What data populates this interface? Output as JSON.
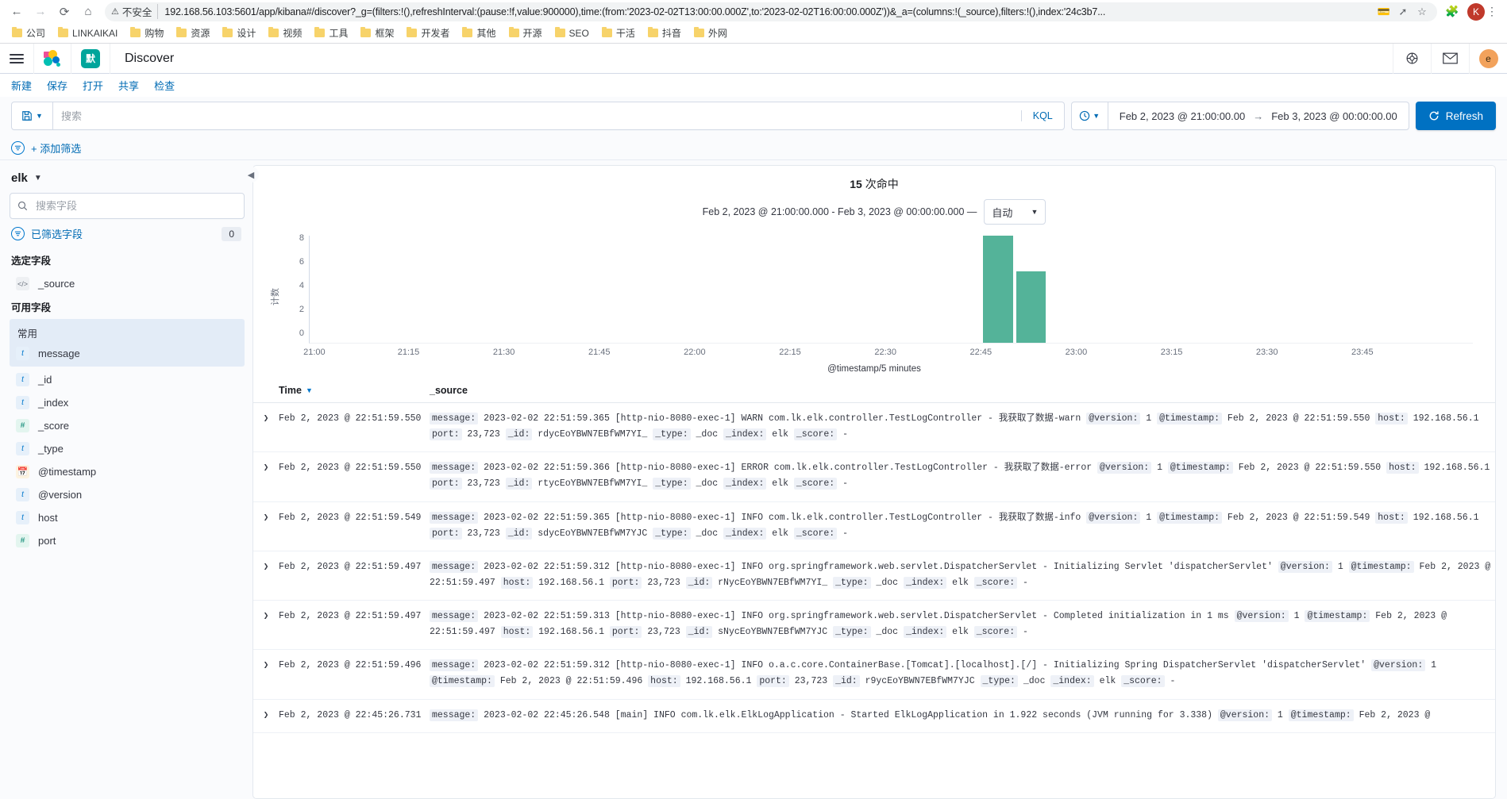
{
  "browser": {
    "back_icon": "←",
    "forward_icon": "→",
    "reload_icon": "⟳",
    "home_icon": "⌂",
    "security_label": "不安全",
    "url": "192.168.56.103:5601/app/kibana#/discover?_g=(filters:!(),refreshInterval:(pause:!f,value:900000),time:(from:'2023-02-02T13:00:00.000Z',to:'2023-02-02T16:00:00.000Z'))&_a=(columns:!(_source),filters:!(),index:'24c3b7...",
    "profile_initial": "K",
    "bookmarks": [
      {
        "label": "公司"
      },
      {
        "label": "LINKAIKAI"
      },
      {
        "label": "购物"
      },
      {
        "label": "资源"
      },
      {
        "label": "设计"
      },
      {
        "label": "视频"
      },
      {
        "label": "工具"
      },
      {
        "label": "框架"
      },
      {
        "label": "开发者"
      },
      {
        "label": "其他"
      },
      {
        "label": "开源"
      },
      {
        "label": "SEO"
      },
      {
        "label": "干活"
      },
      {
        "label": "抖音"
      },
      {
        "label": "外网"
      }
    ]
  },
  "header": {
    "space_badge": "默",
    "app_title": "Discover",
    "avatar_initial": "e"
  },
  "topnav": [
    {
      "label": "新建"
    },
    {
      "label": "保存"
    },
    {
      "label": "打开"
    },
    {
      "label": "共享"
    },
    {
      "label": "检查"
    }
  ],
  "query": {
    "placeholder": "搜索",
    "value": "",
    "language": "KQL",
    "date_from": "Feb 2, 2023 @ 21:00:00.00",
    "date_to": "Feb 3, 2023 @ 00:00:00.00",
    "range_arrow": "→",
    "refresh_label": "Refresh"
  },
  "filters": {
    "add_filter_label": "+ 添加筛选"
  },
  "sidebar": {
    "index_pattern": "elk",
    "field_search_placeholder": "搜索字段",
    "filtered_fields_label": "已筛选字段",
    "filtered_fields_count": "0",
    "selected_fields_title": "选定字段",
    "available_fields_title": "可用字段",
    "popular_group_title": "常用",
    "selected_fields": [
      {
        "name": "_source",
        "type": "source"
      }
    ],
    "popular_fields": [
      {
        "name": "message",
        "type": "string"
      }
    ],
    "available_fields": [
      {
        "name": "_id",
        "type": "string"
      },
      {
        "name": "_index",
        "type": "string"
      },
      {
        "name": "_score",
        "type": "number"
      },
      {
        "name": "_type",
        "type": "string"
      },
      {
        "name": "@timestamp",
        "type": "date"
      },
      {
        "name": "@version",
        "type": "string"
      },
      {
        "name": "host",
        "type": "string"
      },
      {
        "name": "port",
        "type": "number"
      }
    ]
  },
  "histogram": {
    "hits_count": "15",
    "hits_label": "次命中",
    "range_text": "Feb 2, 2023 @ 21:00:00.000 - Feb 3, 2023 @ 00:00:00.000 —",
    "interval_value": "自动"
  },
  "chart_data": {
    "type": "bar",
    "title": "15 次命中",
    "xlabel": "@timestamp/5 minutes",
    "ylabel": "计数",
    "categories": [
      "21:00",
      "21:05",
      "21:10",
      "21:15",
      "21:20",
      "21:25",
      "21:30",
      "21:35",
      "21:40",
      "21:45",
      "21:50",
      "21:55",
      "22:00",
      "22:05",
      "22:10",
      "22:15",
      "22:20",
      "22:25",
      "22:30",
      "22:35",
      "22:40",
      "22:45",
      "22:50",
      "22:55",
      "23:00",
      "23:05",
      "23:10",
      "23:15",
      "23:20",
      "23:25",
      "23:30",
      "23:35",
      "23:40",
      "23:45",
      "23:50",
      "23:55"
    ],
    "values": [
      0,
      0,
      0,
      0,
      0,
      0,
      0,
      0,
      0,
      0,
      0,
      0,
      0,
      0,
      0,
      0,
      0,
      0,
      0,
      0,
      0,
      9,
      6,
      0,
      0,
      0,
      0,
      0,
      0,
      0,
      0,
      0,
      0,
      0,
      0,
      0
    ],
    "x_ticks": [
      "21:00",
      "21:15",
      "21:30",
      "21:45",
      "22:00",
      "22:15",
      "22:30",
      "22:45",
      "23:00",
      "23:15",
      "23:30",
      "23:45"
    ],
    "y_ticks": [
      "0",
      "2",
      "4",
      "6",
      "8"
    ],
    "ylim": [
      0,
      9
    ],
    "grid": false,
    "legend": "none",
    "bar_color": "#54b399"
  },
  "table": {
    "columns": {
      "time": "Time",
      "source": "_source"
    },
    "rows": [
      {
        "time": "Feb 2, 2023 @ 22:51:59.550",
        "parts": [
          {
            "k": "message:",
            "v": "2023-02-02 22:51:59.365 [http-nio-8080-exec-1] WARN com.lk.elk.controller.TestLogController - 我获取了数据-warn"
          },
          {
            "k": "@version:",
            "v": "1"
          },
          {
            "k": "@timestamp:",
            "v": "Feb 2, 2023 @ 22:51:59.550"
          },
          {
            "k": "host:",
            "v": "192.168.56.1"
          },
          {
            "k": "port:",
            "v": "23,723"
          },
          {
            "k": "_id:",
            "v": "rdycEoYBWN7EBfWM7YI_"
          },
          {
            "k": "_type:",
            "v": "_doc"
          },
          {
            "k": "_index:",
            "v": "elk"
          },
          {
            "k": "_score:",
            "v": "-"
          }
        ]
      },
      {
        "time": "Feb 2, 2023 @ 22:51:59.550",
        "parts": [
          {
            "k": "message:",
            "v": "2023-02-02 22:51:59.366 [http-nio-8080-exec-1] ERROR com.lk.elk.controller.TestLogController - 我获取了数据-error"
          },
          {
            "k": "@version:",
            "v": "1"
          },
          {
            "k": "@timestamp:",
            "v": "Feb 2, 2023 @ 22:51:59.550"
          },
          {
            "k": "host:",
            "v": "192.168.56.1"
          },
          {
            "k": "port:",
            "v": "23,723"
          },
          {
            "k": "_id:",
            "v": "rtycEoYBWN7EBfWM7YI_"
          },
          {
            "k": "_type:",
            "v": "_doc"
          },
          {
            "k": "_index:",
            "v": "elk"
          },
          {
            "k": "_score:",
            "v": "-"
          }
        ]
      },
      {
        "time": "Feb 2, 2023 @ 22:51:59.549",
        "parts": [
          {
            "k": "message:",
            "v": "2023-02-02 22:51:59.365 [http-nio-8080-exec-1] INFO com.lk.elk.controller.TestLogController - 我获取了数据-info"
          },
          {
            "k": "@version:",
            "v": "1"
          },
          {
            "k": "@timestamp:",
            "v": "Feb 2, 2023 @ 22:51:59.549"
          },
          {
            "k": "host:",
            "v": "192.168.56.1"
          },
          {
            "k": "port:",
            "v": "23,723"
          },
          {
            "k": "_id:",
            "v": "sdycEoYBWN7EBfWM7YJC"
          },
          {
            "k": "_type:",
            "v": "_doc"
          },
          {
            "k": "_index:",
            "v": "elk"
          },
          {
            "k": "_score:",
            "v": "-"
          }
        ]
      },
      {
        "time": "Feb 2, 2023 @ 22:51:59.497",
        "parts": [
          {
            "k": "message:",
            "v": "2023-02-02 22:51:59.312 [http-nio-8080-exec-1] INFO org.springframework.web.servlet.DispatcherServlet - Initializing Servlet 'dispatcherServlet'"
          },
          {
            "k": "@version:",
            "v": "1"
          },
          {
            "k": "@timestamp:",
            "v": "Feb 2, 2023 @ 22:51:59.497"
          },
          {
            "k": "host:",
            "v": "192.168.56.1"
          },
          {
            "k": "port:",
            "v": "23,723"
          },
          {
            "k": "_id:",
            "v": "rNycEoYBWN7EBfWM7YI_"
          },
          {
            "k": "_type:",
            "v": "_doc"
          },
          {
            "k": "_index:",
            "v": "elk"
          },
          {
            "k": "_score:",
            "v": "-"
          }
        ]
      },
      {
        "time": "Feb 2, 2023 @ 22:51:59.497",
        "parts": [
          {
            "k": "message:",
            "v": "2023-02-02 22:51:59.313 [http-nio-8080-exec-1] INFO org.springframework.web.servlet.DispatcherServlet - Completed initialization in 1 ms"
          },
          {
            "k": "@version:",
            "v": "1"
          },
          {
            "k": "@timestamp:",
            "v": "Feb 2, 2023 @ 22:51:59.497"
          },
          {
            "k": "host:",
            "v": "192.168.56.1"
          },
          {
            "k": "port:",
            "v": "23,723"
          },
          {
            "k": "_id:",
            "v": "sNycEoYBWN7EBfWM7YJC"
          },
          {
            "k": "_type:",
            "v": "_doc"
          },
          {
            "k": "_index:",
            "v": "elk"
          },
          {
            "k": "_score:",
            "v": "-"
          }
        ]
      },
      {
        "time": "Feb 2, 2023 @ 22:51:59.496",
        "parts": [
          {
            "k": "message:",
            "v": "2023-02-02 22:51:59.312 [http-nio-8080-exec-1] INFO o.a.c.core.ContainerBase.[Tomcat].[localhost].[/] - Initializing Spring DispatcherServlet 'dispatcherServlet'"
          },
          {
            "k": "@version:",
            "v": "1"
          },
          {
            "k": "@timestamp:",
            "v": "Feb 2, 2023 @ 22:51:59.496"
          },
          {
            "k": "host:",
            "v": "192.168.56.1"
          },
          {
            "k": "port:",
            "v": "23,723"
          },
          {
            "k": "_id:",
            "v": "r9ycEoYBWN7EBfWM7YJC"
          },
          {
            "k": "_type:",
            "v": "_doc"
          },
          {
            "k": "_index:",
            "v": "elk"
          },
          {
            "k": "_score:",
            "v": "-"
          }
        ]
      },
      {
        "time": "Feb 2, 2023 @ 22:45:26.731",
        "parts": [
          {
            "k": "message:",
            "v": "2023-02-02 22:45:26.548 [main] INFO com.lk.elk.ElkLogApplication - Started ElkLogApplication in 1.922 seconds (JVM running for 3.338)"
          },
          {
            "k": "@version:",
            "v": "1"
          },
          {
            "k": "@timestamp:",
            "v": "Feb 2, 2023 @"
          }
        ]
      }
    ]
  }
}
